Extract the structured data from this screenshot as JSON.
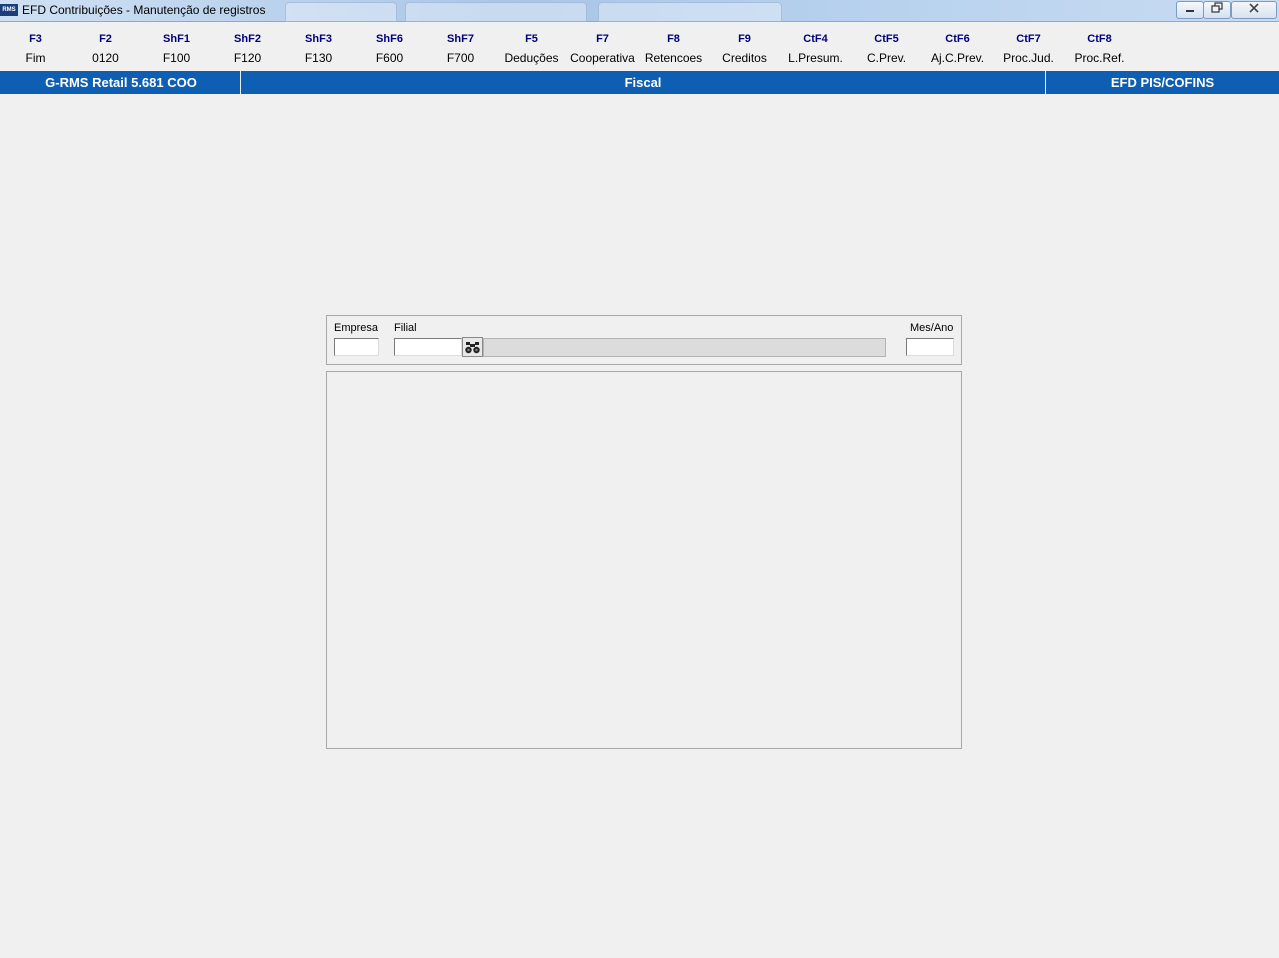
{
  "window": {
    "title": "EFD Contribuições - Manutenção de registros",
    "app_icon_text": "RMS"
  },
  "fkeys": [
    {
      "key": "F3",
      "label": "Fim"
    },
    {
      "key": "F2",
      "label": "0120"
    },
    {
      "key": "ShF1",
      "label": "F100"
    },
    {
      "key": "ShF2",
      "label": "F120"
    },
    {
      "key": "ShF3",
      "label": "F130"
    },
    {
      "key": "ShF6",
      "label": "F600"
    },
    {
      "key": "ShF7",
      "label": "F700"
    },
    {
      "key": "F5",
      "label": "Deduções"
    },
    {
      "key": "F7",
      "label": "Cooperativa"
    },
    {
      "key": "F8",
      "label": "Retencoes"
    },
    {
      "key": "F9",
      "label": "Creditos"
    },
    {
      "key": "CtF4",
      "label": "L.Presum."
    },
    {
      "key": "CtF5",
      "label": "C.Prev."
    },
    {
      "key": "CtF6",
      "label": "Aj.C.Prev."
    },
    {
      "key": "CtF7",
      "label": "Proc.Jud."
    },
    {
      "key": "CtF8",
      "label": "Proc.Ref."
    }
  ],
  "statusbar": {
    "left": "G-RMS Retail 5.681 COO",
    "center": "Fiscal",
    "right": "EFD PIS/COFINS"
  },
  "filter": {
    "empresa_label": "Empresa",
    "empresa_value": "",
    "filial_label": "Filial",
    "filial_value": "",
    "filial_description": "",
    "mesano_label": "Mes/Ano",
    "mesano_value": ""
  },
  "colors": {
    "statusbar_bg": "#0e5fb4",
    "fkey_text": "#00007a",
    "window_bg": "#f0f0f0"
  }
}
